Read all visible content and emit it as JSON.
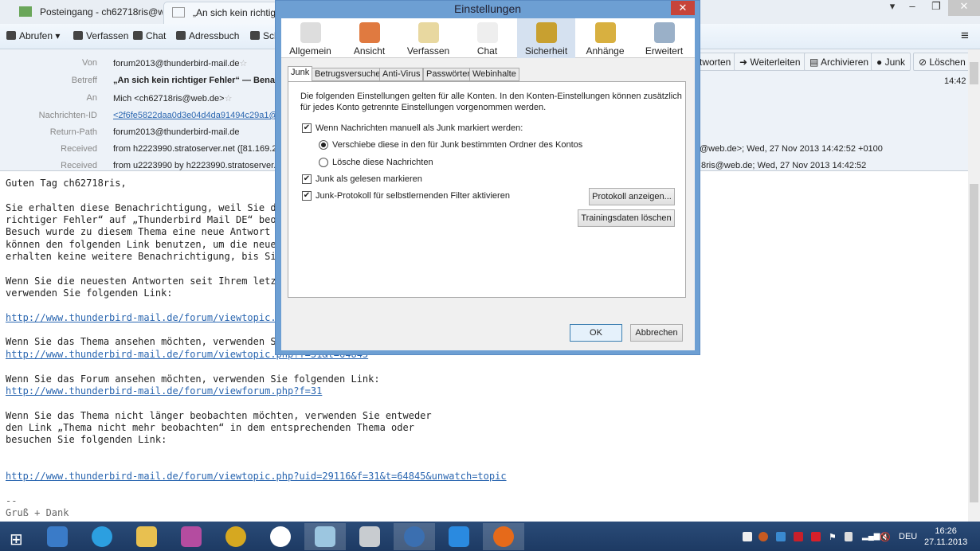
{
  "tabs": [
    {
      "label": "Posteingang - ch62718ris@w..."
    },
    {
      "label": "„An sich kein richtiger Fe"
    }
  ],
  "toolbar": {
    "abrufen": "Abrufen",
    "verfassen": "Verfassen",
    "chat": "Chat",
    "adressbuch": "Adressbuch",
    "schlagwoerter": "Sch"
  },
  "header": {
    "actions": [
      "tworten",
      "Weiterleiten",
      "Archivieren",
      "Junk",
      "Löschen"
    ],
    "time": "14:42",
    "fields": [
      {
        "label": "Von",
        "value": "forum2013@thunderbird-mail.de"
      },
      {
        "label": "Betreff",
        "value": "„An sich kein richtiger Fehler“ — Benach"
      },
      {
        "label": "An",
        "value": "Mich <ch62718ris@web.de>"
      },
      {
        "label": "Nachrichten-ID",
        "value": "<2f6fe5822daa0d3e04d4da91494c29a1@ww"
      },
      {
        "label": "Return-Path",
        "value": "forum2013@thunderbird-mail.de"
      },
      {
        "label": "Received",
        "value": "from h2223990.stratoserver.net ([81.169.202",
        "tail": "@web.de>; Wed, 27 Nov 2013 14:42:52 +0100"
      },
      {
        "label": "Received",
        "value": "from u2223990 by h2223990.stratoserver.ne",
        "tail": "8ris@web.de; Wed, 27 Nov 2013 14:42:52"
      }
    ]
  },
  "body": {
    "lines": [
      "Guten Tag ch62718ris,",
      "",
      "Sie erhalten diese Benachrichtigung, weil Sie d",
      "richtiger Fehler“ auf „Thunderbird Mail DE“ beo",
      "Besuch wurde zu diesem Thema eine neue Antwort",
      "können den folgenden Link benutzen, um die neue",
      "erhalten keine weitere Benachrichtigung, bis Si",
      "",
      "Wenn Sie die neuesten Antworten seit Ihrem letz",
      "verwenden Sie folgenden Link:",
      "",
      "http://www.thunderbird-mail.de/forum/viewtopic.",
      "",
      "Wenn Sie das Thema ansehen möchten, verwenden S",
      "http://www.thunderbird-mail.de/forum/viewtopic.php?f=31&t=64845",
      "",
      "Wenn Sie das Forum ansehen möchten, verwenden Sie folgenden Link:",
      "http://www.thunderbird-mail.de/forum/viewforum.php?f=31",
      "",
      "Wenn Sie das Thema nicht länger beobachten möchten, verwenden Sie entweder",
      "den Link „Thema nicht mehr beobachten“ in dem entsprechenden Thema oder",
      "besuchen Sie folgenden Link:",
      "",
      "",
      "http://www.thunderbird-mail.de/forum/viewtopic.php?uid=29116&f=31&t=64845&unwatch=topic",
      "",
      "--",
      "Gruß + Dank"
    ],
    "links": [
      11,
      14,
      17,
      24
    ]
  },
  "dialog": {
    "title": "Einstellungen",
    "panes": [
      "Allgemein",
      "Ansicht",
      "Verfassen",
      "Chat",
      "Sicherheit",
      "Anhänge",
      "Erweitert"
    ],
    "subtabs": [
      "Junk",
      "Betrugsversuche",
      "Anti-Virus",
      "Passwörter",
      "Webinhalte"
    ],
    "intro1": "Die folgenden Einstellungen gelten für alle Konten. In den Konten-Einstellungen können zusätzlich",
    "intro2": "für jedes Konto getrennte Einstellungen vorgenommen werden.",
    "cb_manual": "Wenn Nachrichten manuell als Junk markiert werden:",
    "radio_move": "Verschiebe diese in den für Junk bestimmten Ordner des Kontos",
    "radio_delete": "Lösche diese Nachrichten",
    "cb_read": "Junk als gelesen markieren",
    "cb_log": "Junk-Protokoll für selbstlernenden Filter aktivieren",
    "btn_log": "Protokoll anzeigen...",
    "btn_reset": "Trainingsdaten löschen",
    "ok": "OK",
    "cancel": "Abbrechen"
  },
  "taskbar": {
    "lang": "DEU",
    "time": "16:26",
    "date": "27.11.2013"
  },
  "colors": {
    "dialog_frame": "#6d9fd3",
    "taskbar": "#1d3a63",
    "link": "#2a66b0"
  }
}
